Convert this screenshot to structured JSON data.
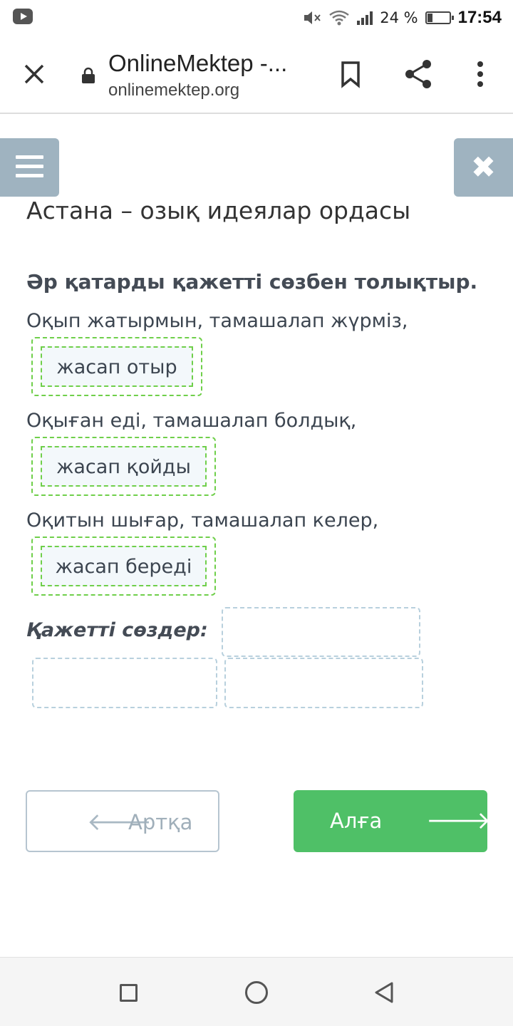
{
  "status_bar": {
    "battery_text": "24 %",
    "battery_level": 0.24,
    "time": "17:54",
    "icons": [
      "youtube-icon",
      "mute-icon",
      "wifi-icon",
      "signal-icon",
      "battery-icon"
    ]
  },
  "browser": {
    "title": "OnlineMektep -...",
    "url": "onlinemektep.org",
    "icons": [
      "close-icon",
      "lock-icon",
      "bookmark-icon",
      "share-icon",
      "more-menu-icon"
    ]
  },
  "page": {
    "title": "Астана – озық идеялар ордасы",
    "instruction": "Әр қатарды қажетті сөзбен толықтыр.",
    "rows": [
      {
        "sentence": "Оқып жатырмын, тамашалап жүрміз,",
        "answer": "жасап отыр"
      },
      {
        "sentence": "Оқыған еді, тамашалап болдық,",
        "answer": "жасап қойды"
      },
      {
        "sentence": "Оқитын шығар, тамашалап келер,",
        "answer": "жасап береді"
      }
    ],
    "words_label": "Қажетті сөздер:",
    "back_label": "Артқа",
    "next_label": "Алға",
    "accent_color": "#4fc067",
    "side_button_color": "#9fb3c0"
  }
}
